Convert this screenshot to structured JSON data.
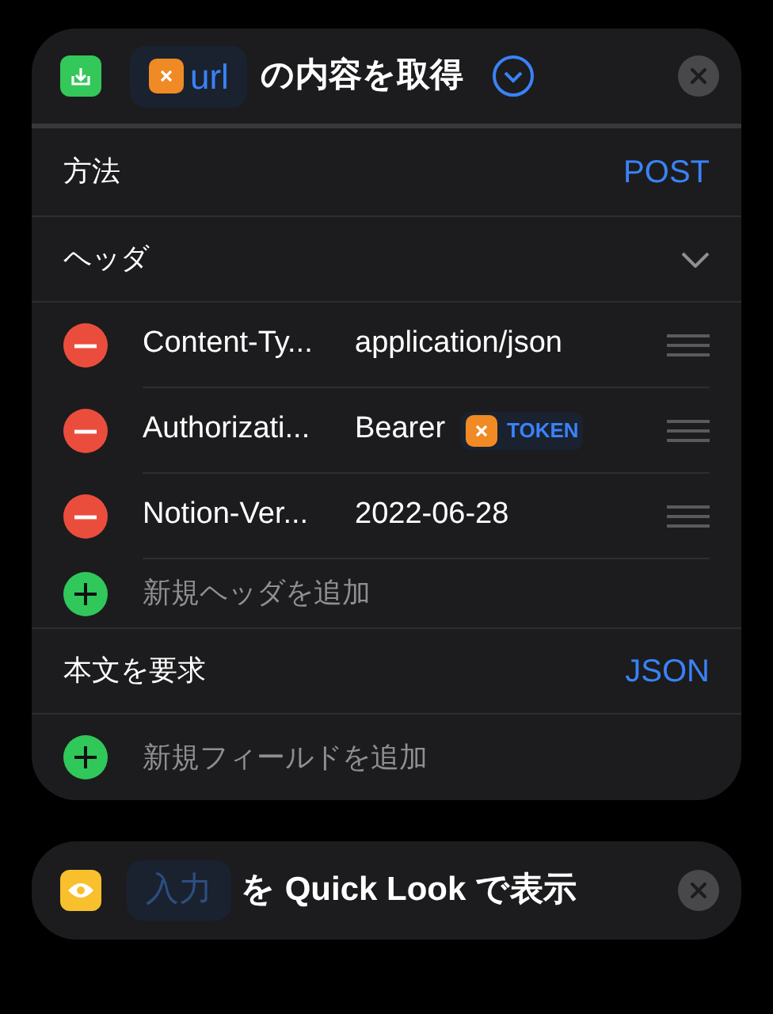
{
  "action": {
    "title_parts": [
      {
        "kind": "variable",
        "text": "url"
      },
      {
        "kind": "text",
        "text": "の内容を取得"
      }
    ],
    "expanded": true,
    "method": {
      "label": "方法",
      "value": "POST"
    },
    "headers": {
      "label": "ヘッダ",
      "expanded": true,
      "items": [
        {
          "key": "Content-Ty...",
          "value": [
            {
              "kind": "text",
              "text": "application/json"
            }
          ]
        },
        {
          "key": "Authorizati...",
          "value": [
            {
              "kind": "text",
              "text": "Bearer"
            },
            {
              "kind": "variable",
              "text": "TOKEN"
            }
          ]
        },
        {
          "key": "Notion-Ver...",
          "value": [
            {
              "kind": "text",
              "text": "2022-06-28"
            }
          ]
        }
      ],
      "add_label": "新規ヘッダを追加"
    },
    "body": {
      "label": "本文を要求",
      "value": "JSON",
      "add_label": "新規フィールドを追加"
    }
  },
  "next_action": {
    "title_parts": [
      {
        "kind": "placeholder",
        "text": "入力"
      },
      {
        "kind": "text",
        "text": "を Quick Look で表示"
      }
    ]
  }
}
